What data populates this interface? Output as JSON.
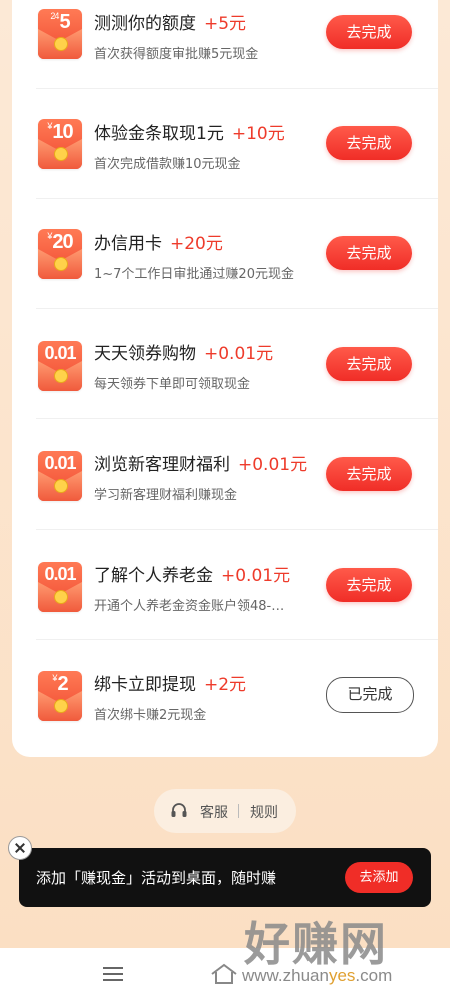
{
  "tasks": [
    {
      "coin_amount": "5",
      "coin_badge": "24",
      "title": "测测你的额度",
      "bonus": "+5元",
      "subtitle": "首次获得额度审批赚5元现金",
      "button": "去完成",
      "done": false
    },
    {
      "coin_amount": "10",
      "title": "体验金条取现1元",
      "bonus": "+10元",
      "subtitle": "首次完成借款赚10元现金",
      "button": "去完成",
      "done": false
    },
    {
      "coin_amount": "20",
      "title": "办信用卡",
      "bonus": "+20元",
      "subtitle": "1~7个工作日审批通过赚20元现金",
      "button": "去完成",
      "done": false
    },
    {
      "coin_amount": "0.01",
      "title": "天天领券购物",
      "bonus": "+0.01元",
      "subtitle": "每天领券下单即可领取现金",
      "button": "去完成",
      "done": false
    },
    {
      "coin_amount": "0.01",
      "title": "浏览新客理财福利",
      "bonus": "+0.01元",
      "subtitle": "学习新客理财福利赚现金",
      "button": "去完成",
      "done": false
    },
    {
      "coin_amount": "0.01",
      "title": "了解个人养老金",
      "bonus": "+0.01元",
      "subtitle": "开通个人养老金资金账户领48-…",
      "button": "去完成",
      "done": false
    },
    {
      "coin_amount": "2",
      "title": "绑卡立即提现",
      "bonus": "+2元",
      "subtitle": "首次绑卡赚2元现金",
      "button": "已完成",
      "done": true
    }
  ],
  "currency_symbol": "¥",
  "support": {
    "service_label": "客服",
    "rules_label": "规则"
  },
  "toast": {
    "message": "添加「赚现金」活动到桌面，随时赚",
    "button": "去添加"
  },
  "watermark": {
    "brand": "好赚网",
    "url_prefix": "www.zhuan",
    "url_highlight": "yes",
    "url_suffix": ".com"
  },
  "colors": {
    "accent": "#f02d27",
    "bonus": "#ee3b2b",
    "toast_bg": "#111111",
    "page_bg": "#fbdfc3"
  }
}
